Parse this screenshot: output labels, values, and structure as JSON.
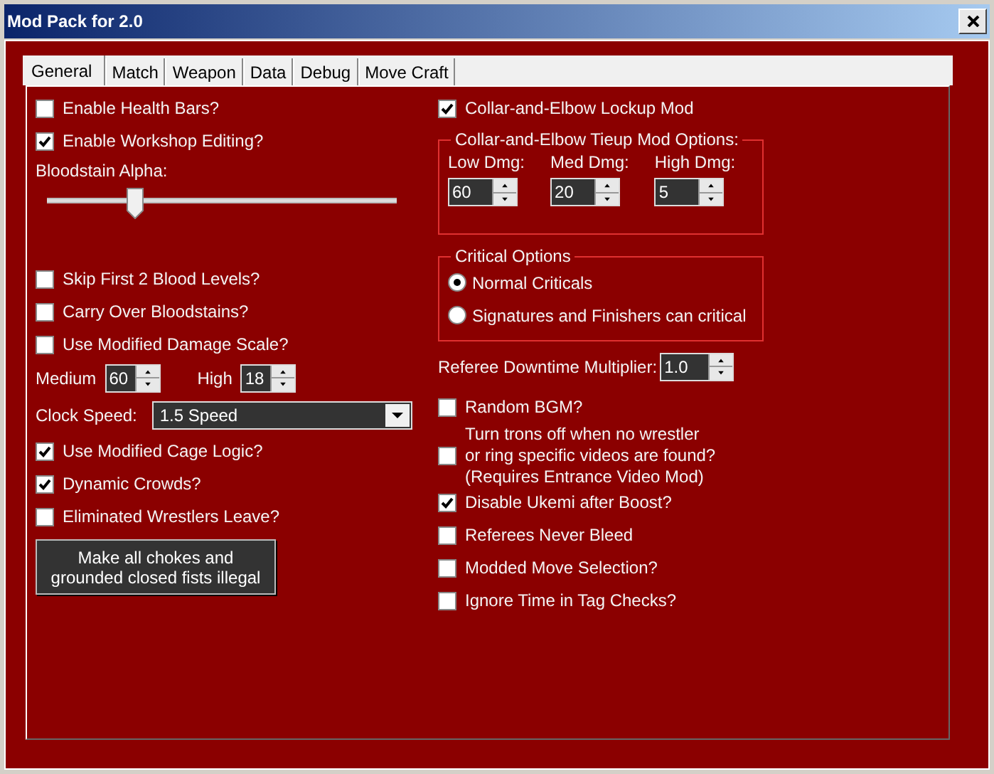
{
  "window": {
    "title": "Mod Pack for 2.0"
  },
  "tabs": [
    {
      "label": "General",
      "selected": true
    },
    {
      "label": "Match",
      "selected": false
    },
    {
      "label": "Weapon",
      "selected": false
    },
    {
      "label": "Data",
      "selected": false
    },
    {
      "label": "Debug",
      "selected": false
    },
    {
      "label": "Move Craft",
      "selected": false
    }
  ],
  "left": [
    {
      "kind": "checkbox",
      "label": "Enable Health Bars?",
      "checked": false
    },
    {
      "kind": "checkbox",
      "label": "Enable Workshop Editing?",
      "checked": true
    },
    {
      "kind": "slider",
      "label": "Bloodstain Alpha:",
      "level": 0.25
    },
    {
      "kind": "checkbox",
      "label": "Skip First 2 Blood Levels?",
      "checked": false
    },
    {
      "kind": "checkbox",
      "label": "Carry Over Bloodstains?",
      "checked": false
    },
    {
      "kind": "checkbox",
      "label": "Use Modified Damage Scale?",
      "checked": false
    },
    {
      "kind": "spinners",
      "fields": [
        {
          "label": "Medium",
          "value": "60"
        },
        {
          "label": "High",
          "value": "18"
        }
      ]
    },
    {
      "kind": "dropdown",
      "label": "Clock Speed:",
      "value": "1.5 Speed"
    },
    {
      "kind": "checkbox",
      "label": "Use Modified Cage Logic?",
      "checked": true
    },
    {
      "kind": "checkbox",
      "label": "Dynamic Crowds?",
      "checked": true
    },
    {
      "kind": "checkbox",
      "label": "Eliminated Wrestlers Leave?",
      "checked": false
    },
    {
      "kind": "button",
      "label": "Make all chokes and grounded closed fists illegal"
    }
  ],
  "right": [
    {
      "kind": "checkbox",
      "label": "Collar-and-Elbow Lockup Mod",
      "checked": true
    },
    {
      "kind": "spin_group",
      "title": "Collar-and-Elbow Tieup Mod Options:",
      "fields": [
        {
          "label": "Low Dmg:",
          "value": "60"
        },
        {
          "label": "Med Dmg:",
          "value": "20"
        },
        {
          "label": "High Dmg:",
          "value": "5"
        }
      ]
    },
    {
      "kind": "radio_group",
      "title": "Critical Options",
      "options": [
        {
          "label": "Normal Criticals",
          "selected": true
        },
        {
          "label": "Signatures and Finishers can critical",
          "selected": false
        }
      ]
    },
    {
      "kind": "spinner",
      "label": "Referee Downtime Multiplier:",
      "value": "1.0"
    },
    {
      "kind": "checkbox",
      "label": "Random BGM?",
      "checked": false
    },
    {
      "kind": "checkbox",
      "label": "Turn trons off when no wrestler\nor ring specific videos are found?\n(Requires Entrance Video Mod)",
      "checked": false
    },
    {
      "kind": "checkbox",
      "label": "Disable Ukemi after Boost?",
      "checked": true
    },
    {
      "kind": "checkbox",
      "label": "Referees Never Bleed",
      "checked": false
    },
    {
      "kind": "checkbox",
      "label": "Modded Move Selection?",
      "checked": false
    },
    {
      "kind": "checkbox",
      "label": "Ignore Time in Tag Checks?",
      "checked": false
    }
  ]
}
